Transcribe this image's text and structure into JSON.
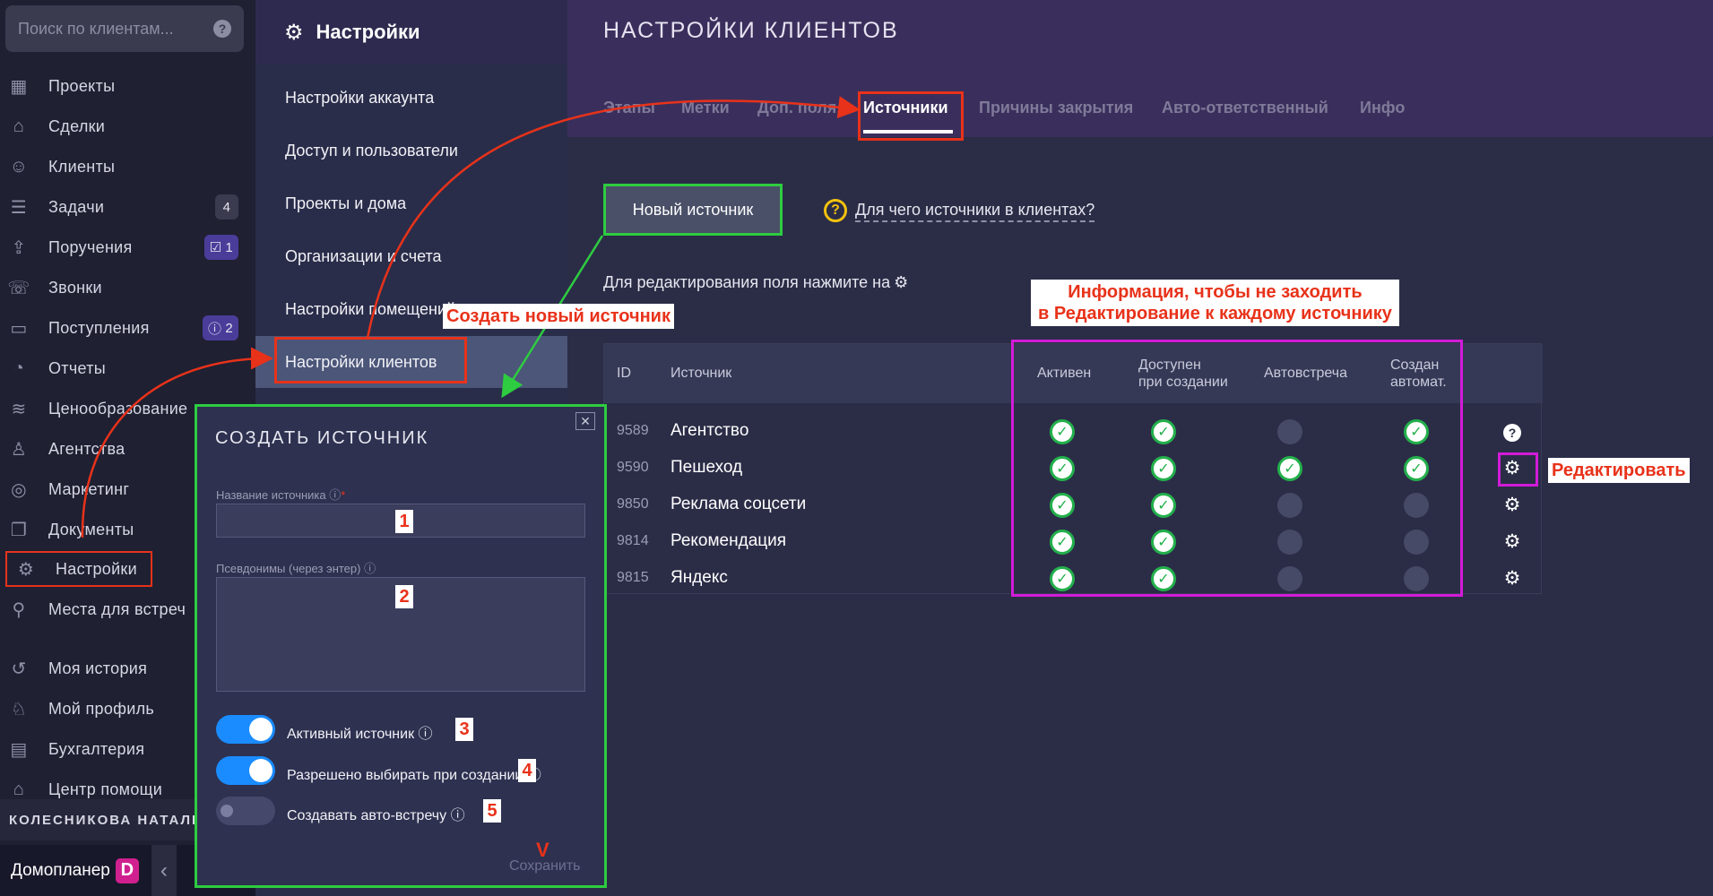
{
  "search": {
    "placeholder": "Поиск по клиентам..."
  },
  "sidebar": {
    "items": [
      {
        "icon": "projects-icon",
        "glyph": "▦",
        "label": "Проекты"
      },
      {
        "icon": "deals-icon",
        "glyph": "⌂",
        "label": "Сделки"
      },
      {
        "icon": "clients-icon",
        "glyph": "☺",
        "label": "Клиенты"
      },
      {
        "icon": "tasks-icon",
        "glyph": "☰",
        "label": "Задачи",
        "badge": "4"
      },
      {
        "icon": "assignments-icon",
        "glyph": "⇪",
        "label": "Поручения",
        "badge": "1",
        "badge_icon": "☑"
      },
      {
        "icon": "calls-icon",
        "glyph": "☏",
        "label": "Звонки"
      },
      {
        "icon": "income-icon",
        "glyph": "▭",
        "label": "Поступления",
        "badge": "2",
        "badge_icon": "ⓘ"
      },
      {
        "icon": "reports-icon",
        "glyph": "◔",
        "label": "Отчеты"
      },
      {
        "icon": "pricing-icon",
        "glyph": "≋",
        "label": "Ценообразование"
      },
      {
        "icon": "agencies-icon",
        "glyph": "♙",
        "label": "Агентства"
      },
      {
        "icon": "marketing-icon",
        "glyph": "◎",
        "label": "Маркетинг"
      },
      {
        "icon": "documents-icon",
        "glyph": "❐",
        "label": "Документы"
      },
      {
        "icon": "settings-icon",
        "glyph": "⚙",
        "label": "Настройки"
      },
      {
        "icon": "meeting-places-icon",
        "glyph": "⚲",
        "label": "Места для встреч"
      },
      {
        "icon": "history-icon",
        "glyph": "↺",
        "label": "Моя история"
      },
      {
        "icon": "profile-icon",
        "glyph": "♘",
        "label": "Мой профиль"
      },
      {
        "icon": "accounting-icon",
        "glyph": "▤",
        "label": "Бухгалтерия"
      },
      {
        "icon": "help-center-icon",
        "glyph": "⌂",
        "label": "Центр помощи"
      }
    ],
    "user_name": "КОЛЕСНИКОВА НАТАЛЬЯ",
    "brand": "Домопланер",
    "brand_logo_letter": "D"
  },
  "settings_menu": {
    "title": "Настройки",
    "items": [
      "Настройки аккаунта",
      "Доступ и пользователи",
      "Проекты и дома",
      "Организации и счета",
      "Настройки помещений",
      "Настройки клиентов"
    ],
    "active_index": 5
  },
  "main": {
    "title": "НАСТРОЙКИ КЛИЕНТОВ",
    "tabs": [
      "Этапы",
      "Метки",
      "Доп. поля",
      "Источники",
      "Причины закрытия",
      "Авто-ответственный",
      "Инфо"
    ],
    "active_tab": "Источники",
    "new_source_button": "Новый источник",
    "why_link": "Для чего источники в клиентах?",
    "edit_hint": "Для редактирования поля нажмите на"
  },
  "table": {
    "headers": {
      "id": "ID",
      "source": "Источник",
      "active": "Активен",
      "available_1": "Доступен",
      "available_2": "при создании",
      "auto_meeting": "Автовстреча",
      "auto_created_1": "Создан",
      "auto_created_2": "автомат."
    },
    "rows": [
      {
        "id": "9589",
        "name": "Агентство",
        "active": true,
        "available": true,
        "auto_meeting": false,
        "auto_created": true,
        "action": "help"
      },
      {
        "id": "9590",
        "name": "Пешеход",
        "active": true,
        "available": true,
        "auto_meeting": true,
        "auto_created": true,
        "action": "gear"
      },
      {
        "id": "9850",
        "name": "Реклама соцсети",
        "active": true,
        "available": true,
        "auto_meeting": false,
        "auto_created": false,
        "action": "gear"
      },
      {
        "id": "9814",
        "name": "Рекомендация",
        "active": true,
        "available": true,
        "auto_meeting": false,
        "auto_created": false,
        "action": "gear"
      },
      {
        "id": "9815",
        "name": "Яндекс",
        "active": true,
        "available": true,
        "auto_meeting": false,
        "auto_created": false,
        "action": "gear"
      }
    ]
  },
  "modal": {
    "title": "СОЗДАТЬ ИСТОЧНИК",
    "name_label": "Название источника",
    "aliases_label": "Псевдонимы (через энтер)",
    "toggles": [
      {
        "label": "Активный источник",
        "on": true,
        "num": "3"
      },
      {
        "label": "Разрешено выбирать при создании",
        "on": true,
        "num": "4"
      },
      {
        "label": "Создавать авто-встречу",
        "on": false,
        "num": "5"
      }
    ],
    "num_name": "1",
    "num_aliases": "2",
    "save_label": "Сохранить",
    "save_mark": "V"
  },
  "annotations": {
    "create_new": "Создать новый источник",
    "info_line1": "Информация, чтобы не заходить",
    "info_line2": "в Редактирование к каждому источнику",
    "edit": "Редактировать"
  },
  "colors": {
    "red_annotation": "#e8321a",
    "green_annotation": "#2ecc40",
    "magenta_annotation": "#d21bd8",
    "check_green": "#23b04b",
    "toggle_blue": "#1a8cff"
  }
}
